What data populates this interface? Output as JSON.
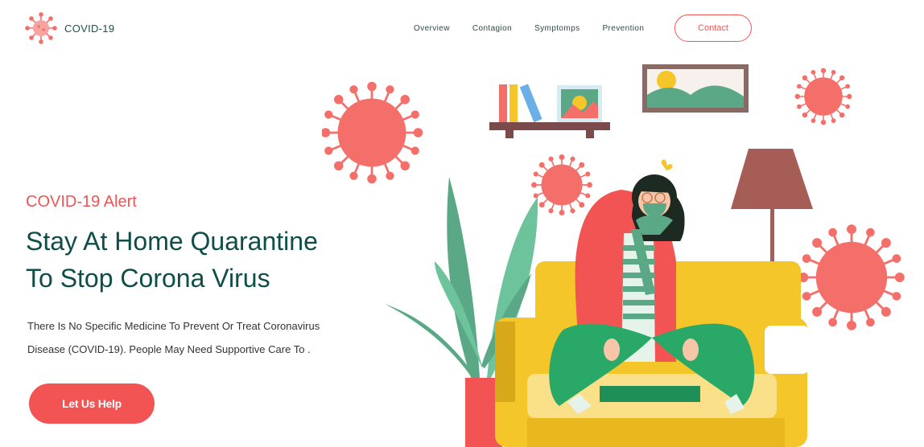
{
  "brand": {
    "name": "COVID-19",
    "icon": "virus-icon"
  },
  "nav": {
    "items": [
      "Overview",
      "Contagion",
      "Symptomps",
      "Prevention"
    ],
    "contact_label": "Contact"
  },
  "hero": {
    "alert": "COVID-19 Alert",
    "headline_line1": "Stay At Home Quarantine",
    "headline_line2": "To Stop Corona Virus",
    "desc_line1": "There Is No Specific Medicine To Prevent Or Treat Coronavirus",
    "desc_line2": "Disease (COVID-19). People May Need Supportive Care To .",
    "cta_label": "Let Us Help"
  },
  "colors": {
    "accent": "#f25454",
    "heading": "#0f4d49",
    "virus": "#f46f6a",
    "sofa": "#f4c62a",
    "plant": "#5aa886"
  }
}
